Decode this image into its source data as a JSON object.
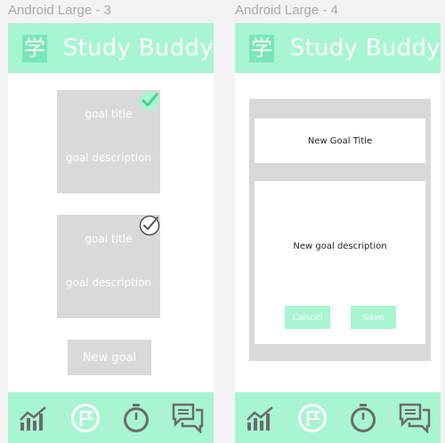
{
  "frames": [
    {
      "label": "Android Large - 3"
    },
    {
      "label": "Android Large - 4"
    }
  ],
  "app": {
    "logo_char": "学",
    "title": "Study Buddy"
  },
  "goals": [
    {
      "title": "goal title",
      "description": "goal description",
      "completed": true
    },
    {
      "title": "goal title",
      "description": "goal description",
      "completed": false
    }
  ],
  "new_goal_button": "New goal",
  "dialog": {
    "title_placeholder": "New Goal Title",
    "description_placeholder": "New goal description",
    "cancel_label": "Cancel",
    "save_label": "Save"
  },
  "nav": [
    "stats-chart-icon",
    "flag-icon",
    "stopwatch-icon",
    "chat-icon"
  ],
  "colors": {
    "accent": "#a8f5d2",
    "logo_bg": "#79e6b9",
    "card": "#d9d9d9",
    "icon": "#6b6b6b",
    "check": "#4fcf93"
  }
}
